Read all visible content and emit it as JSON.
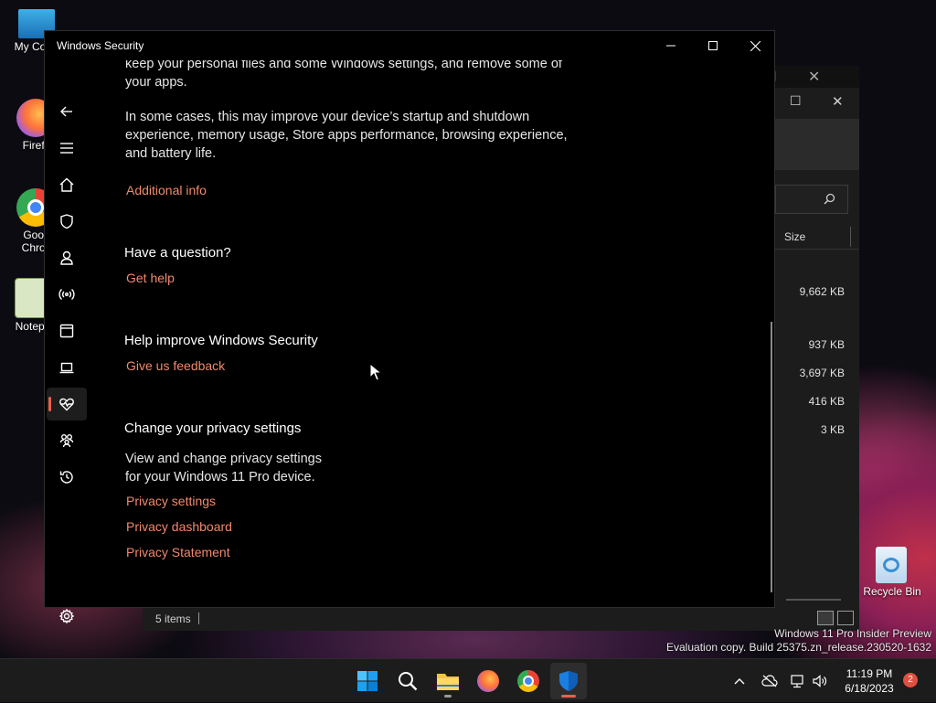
{
  "desktop": {
    "icons": [
      {
        "label": "My Com"
      },
      {
        "label": "Firefo"
      },
      {
        "label": "Goog"
      },
      {
        "label": "Chron"
      },
      {
        "label": "Notepa"
      },
      {
        "label": "Recycle Bin"
      }
    ],
    "watermark": {
      "line1": "Windows 11 Pro Insider Preview",
      "line2": "Evaluation copy. Build 25375.zn_release.230520-1632"
    }
  },
  "explorer": {
    "column_header": "Size",
    "sizes": [
      "9,662 KB",
      "937 KB",
      "3,697 KB",
      "416 KB",
      "3 KB"
    ],
    "status_items": "5 items"
  },
  "window": {
    "title": "Windows Security",
    "nav": [
      {
        "icon": "back-arrow-icon"
      },
      {
        "icon": "hamburger-menu-icon"
      },
      {
        "icon": "home-icon"
      },
      {
        "icon": "shield-icon"
      },
      {
        "icon": "person-icon"
      },
      {
        "icon": "wireless-icon"
      },
      {
        "icon": "app-browser-icon"
      },
      {
        "icon": "laptop-icon"
      },
      {
        "icon": "heart-pulse-icon",
        "active": true
      },
      {
        "icon": "family-icon"
      },
      {
        "icon": "history-icon"
      },
      {
        "icon": "gear-icon"
      }
    ]
  },
  "content": {
    "intro_partial": "keep your personal files and some Windows settings, and remove some of your apps.",
    "intro_line1": "keep your personal files and some Windows settings, and remove some of",
    "intro_line2": "your apps.",
    "improve_para": "In some cases, this may improve your device’s startup and shutdown experience, memory usage, Store apps performance, browsing experience, and battery life.",
    "additional_info": "Additional info",
    "question_heading": "Have a question?",
    "get_help": "Get help",
    "improve_heading": "Help improve Windows Security",
    "feedback": "Give us feedback",
    "privacy_heading": "Change your privacy settings",
    "privacy_para": "View and change privacy settings for your Windows 11 Pro device.",
    "privacy_settings": "Privacy settings",
    "privacy_dashboard": "Privacy dashboard",
    "privacy_statement": "Privacy Statement",
    "accent_link_color": "#f08a6c"
  },
  "taskbar": {
    "apps": [
      "start-icon",
      "search-icon",
      "file-explorer-icon",
      "firefox-icon",
      "chrome-icon",
      "windows-security-icon"
    ],
    "time": "11:19 PM",
    "date": "6/18/2023",
    "notification_count": "2"
  }
}
